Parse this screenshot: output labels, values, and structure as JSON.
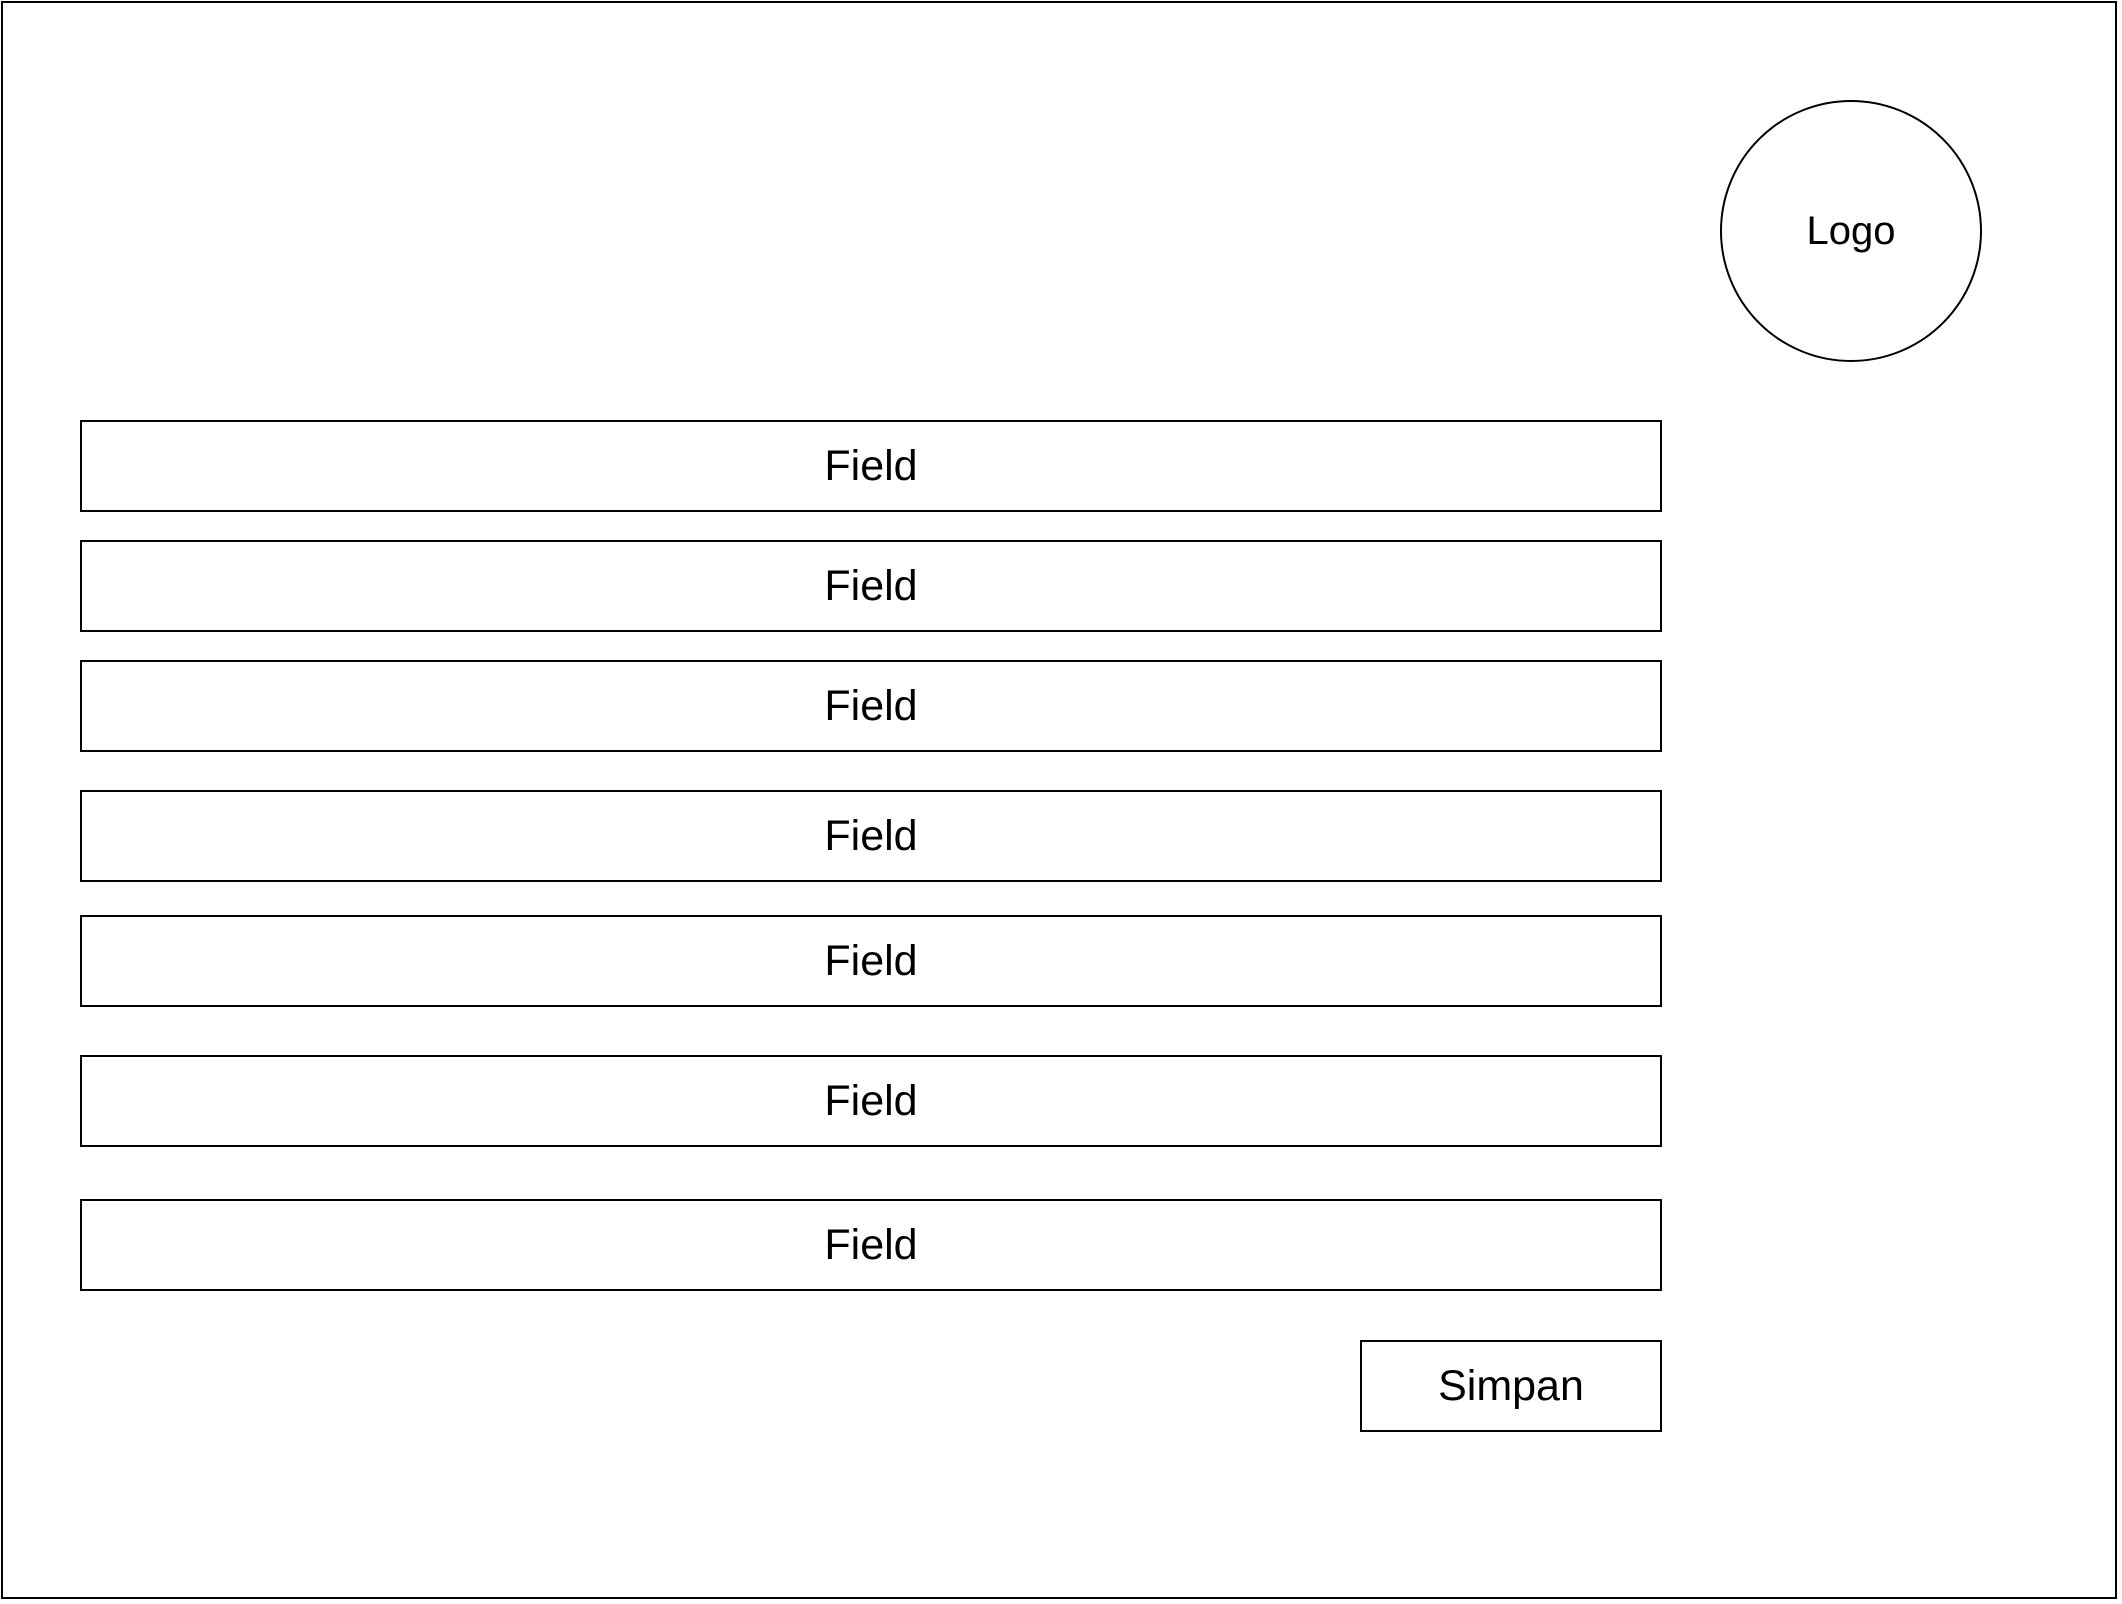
{
  "header": {
    "logo_label": "Logo"
  },
  "form": {
    "fields": [
      {
        "label": "Field"
      },
      {
        "label": "Field"
      },
      {
        "label": "Field"
      },
      {
        "label": "Field"
      },
      {
        "label": "Field"
      },
      {
        "label": "Field"
      },
      {
        "label": "Field"
      }
    ],
    "save_label": "Simpan"
  }
}
